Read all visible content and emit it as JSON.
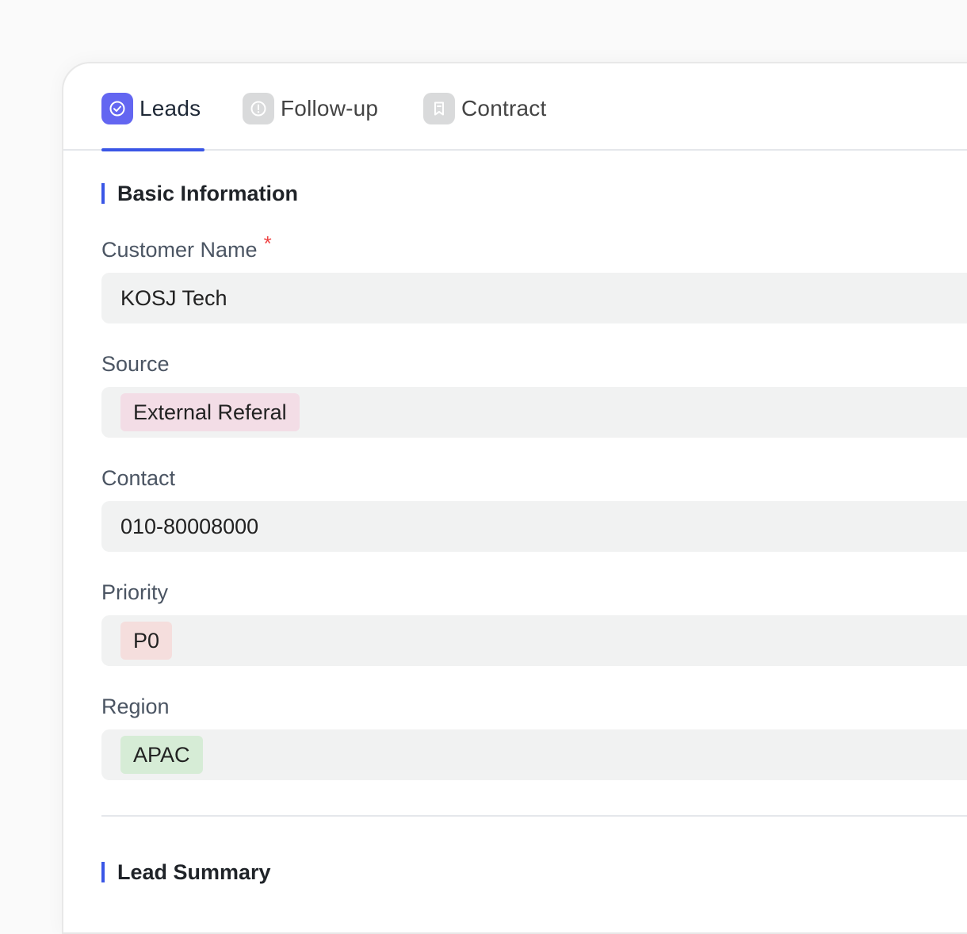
{
  "tabs": [
    {
      "label": "Leads",
      "icon": "check-circle-icon",
      "active": true,
      "icon_bg": "#6366f1"
    },
    {
      "label": "Follow-up",
      "icon": "alert-circle-icon",
      "active": false,
      "icon_bg": "#d9dadb"
    },
    {
      "label": "Contract",
      "icon": "bookmark-doc-icon",
      "active": false,
      "icon_bg": "#d9dadb"
    }
  ],
  "sections": {
    "basic": {
      "title": "Basic Information"
    },
    "summary": {
      "title": "Lead Summary"
    }
  },
  "fields": {
    "customer_name": {
      "label": "Customer Name",
      "required_mark": "*",
      "value": "KOSJ Tech"
    },
    "source": {
      "label": "Source",
      "value": "External Referal",
      "tag_color": "#f3dde6"
    },
    "contact": {
      "label": "Contact",
      "value": "010-80008000"
    },
    "priority": {
      "label": "Priority",
      "value": "P0",
      "tag_color": "#f5dedd"
    },
    "region": {
      "label": "Region",
      "value": "APAC",
      "tag_color": "#d6ecd6"
    }
  },
  "colors": {
    "accent": "#3a56e6",
    "required": "#ef4444",
    "field_bg": "#f1f2f2"
  }
}
